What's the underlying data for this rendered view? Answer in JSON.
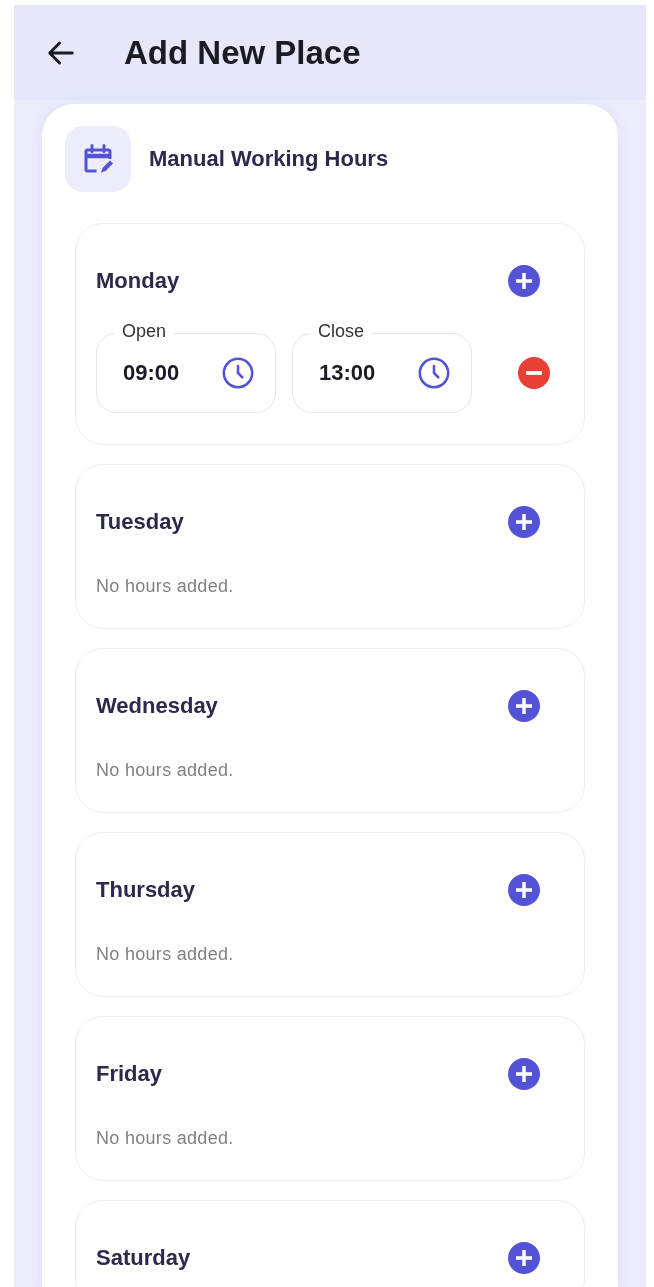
{
  "header": {
    "title": "Add New Place"
  },
  "section": {
    "title": "Manual Working Hours"
  },
  "days": [
    {
      "name": "Monday",
      "slots": [
        {
          "open_label": "Open",
          "open": "09:00",
          "close_label": "Close",
          "close": "13:00"
        }
      ]
    },
    {
      "name": "Tuesday",
      "empty_text": "No hours added."
    },
    {
      "name": "Wednesday",
      "empty_text": "No hours added."
    },
    {
      "name": "Thursday",
      "empty_text": "No hours added."
    },
    {
      "name": "Friday",
      "empty_text": "No hours added."
    },
    {
      "name": "Saturday"
    }
  ]
}
